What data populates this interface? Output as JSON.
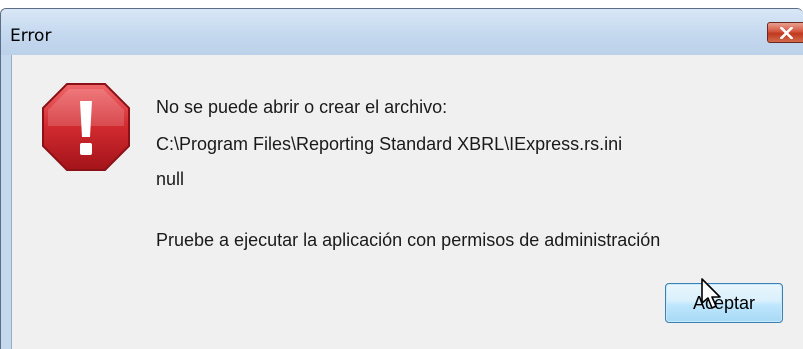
{
  "window": {
    "title": "Error"
  },
  "dialog": {
    "icon": "error-exclamation-icon",
    "message_line1": "No se puede abrir o crear el archivo:",
    "message_line2": "C:\\Program Files\\Reporting Standard XBRL\\IExpress.rs.ini",
    "message_line3": "null",
    "message_line4": "Pruebe a ejecutar la aplicación con permisos de administración",
    "ok_label": "Aceptar"
  },
  "colors": {
    "error_red": "#c8161d",
    "close_red": "#c74a32",
    "button_border": "#3c7fb1"
  },
  "icons": {
    "close": "close-icon",
    "cursor": "mouse-pointer-icon"
  }
}
